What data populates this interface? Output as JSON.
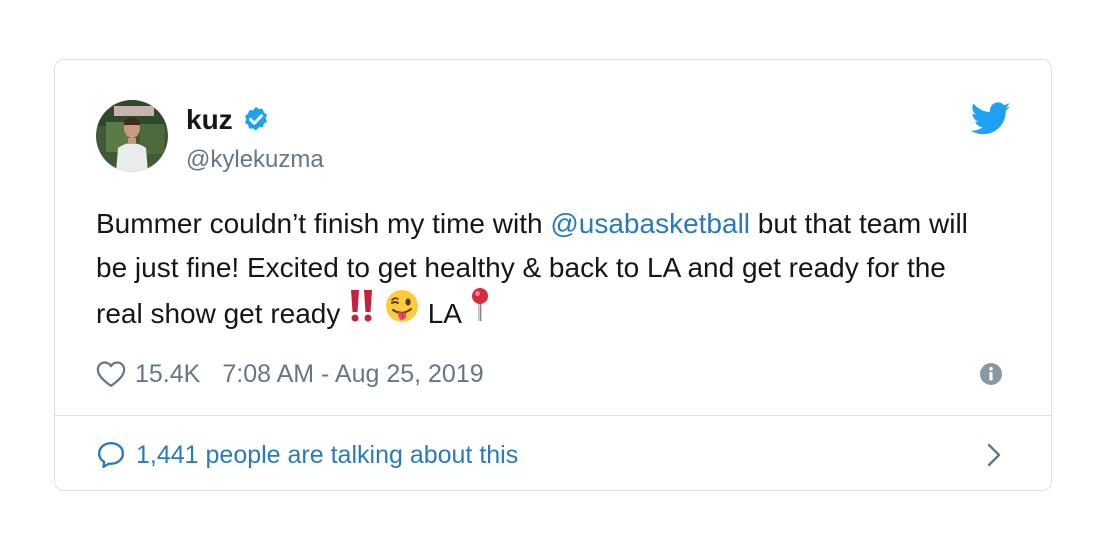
{
  "tweet": {
    "display_name": "kuz",
    "handle": "@kylekuzma",
    "text_part1": "Bummer couldn’t finish my time with ",
    "mention": "@usabasketball",
    "text_part2": " but that team will be just fine! Excited to get healthy & back to LA and get ready for the real show get ready ",
    "text_part3": " LA ",
    "likes": "15.4K",
    "timestamp": "7:08 AM - Aug 25, 2019",
    "talking": "1,441 people are talking about this"
  },
  "icons": {
    "verified": "verified-badge-icon",
    "bird": "twitter-bird-icon",
    "heart": "heart-icon",
    "info": "info-icon",
    "bubble": "speech-bubble-icon",
    "chevron": "chevron-right-icon",
    "emoji_1": "double-exclamation-emoji",
    "emoji_2": "winking-face-with-tongue-emoji",
    "emoji_3": "round-pushpin-emoji"
  },
  "colors": {
    "accent": "#1da1f2",
    "link": "#2b7bb9",
    "text": "#14171a",
    "muted": "#657786",
    "border": "#dcdfe3"
  }
}
